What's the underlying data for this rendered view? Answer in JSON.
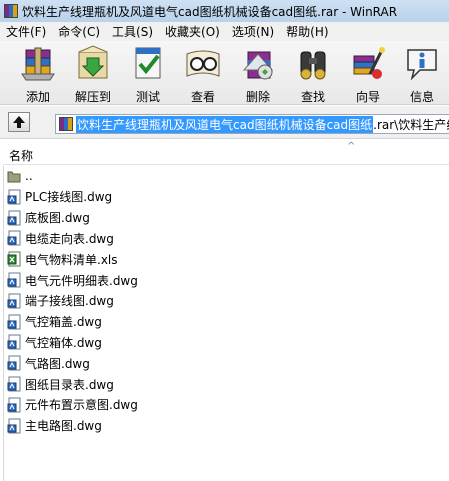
{
  "window": {
    "title": "饮料生产线理瓶机及风道电气cad图纸机械设备cad图纸.rar - WinRAR"
  },
  "menu": [
    "文件(F)",
    "命令(C)",
    "工具(S)",
    "收藏夹(O)",
    "选项(N)",
    "帮助(H)"
  ],
  "toolbar": [
    {
      "label": "添加",
      "icon": "add-archive-icon"
    },
    {
      "label": "解压到",
      "icon": "extract-to-icon"
    },
    {
      "label": "测试",
      "icon": "test-icon"
    },
    {
      "label": "查看",
      "icon": "view-icon"
    },
    {
      "label": "删除",
      "icon": "delete-icon"
    },
    {
      "label": "查找",
      "icon": "find-icon"
    },
    {
      "label": "向导",
      "icon": "wizard-icon"
    },
    {
      "label": "信息",
      "icon": "info-icon"
    }
  ],
  "address": {
    "selected": "饮料生产线理瓶机及风道电气cad图纸机械设备cad图纸",
    "rest": ".rar\\饮料生产线"
  },
  "columns": {
    "name": "名称"
  },
  "files": [
    {
      "name": "..",
      "type": "parent"
    },
    {
      "name": "PLC接线图.dwg",
      "type": "dwg"
    },
    {
      "name": "底板图.dwg",
      "type": "dwg"
    },
    {
      "name": "电缆走向表.dwg",
      "type": "dwg"
    },
    {
      "name": "电气物料清单.xls",
      "type": "xls"
    },
    {
      "name": "电气元件明细表.dwg",
      "type": "dwg"
    },
    {
      "name": "端子接线图.dwg",
      "type": "dwg"
    },
    {
      "name": "气控箱盖.dwg",
      "type": "dwg"
    },
    {
      "name": "气控箱体.dwg",
      "type": "dwg"
    },
    {
      "name": "气路图.dwg",
      "type": "dwg"
    },
    {
      "name": "图纸目录表.dwg",
      "type": "dwg"
    },
    {
      "name": "元件布置示意图.dwg",
      "type": "dwg"
    },
    {
      "name": "主电路图.dwg",
      "type": "dwg"
    }
  ]
}
